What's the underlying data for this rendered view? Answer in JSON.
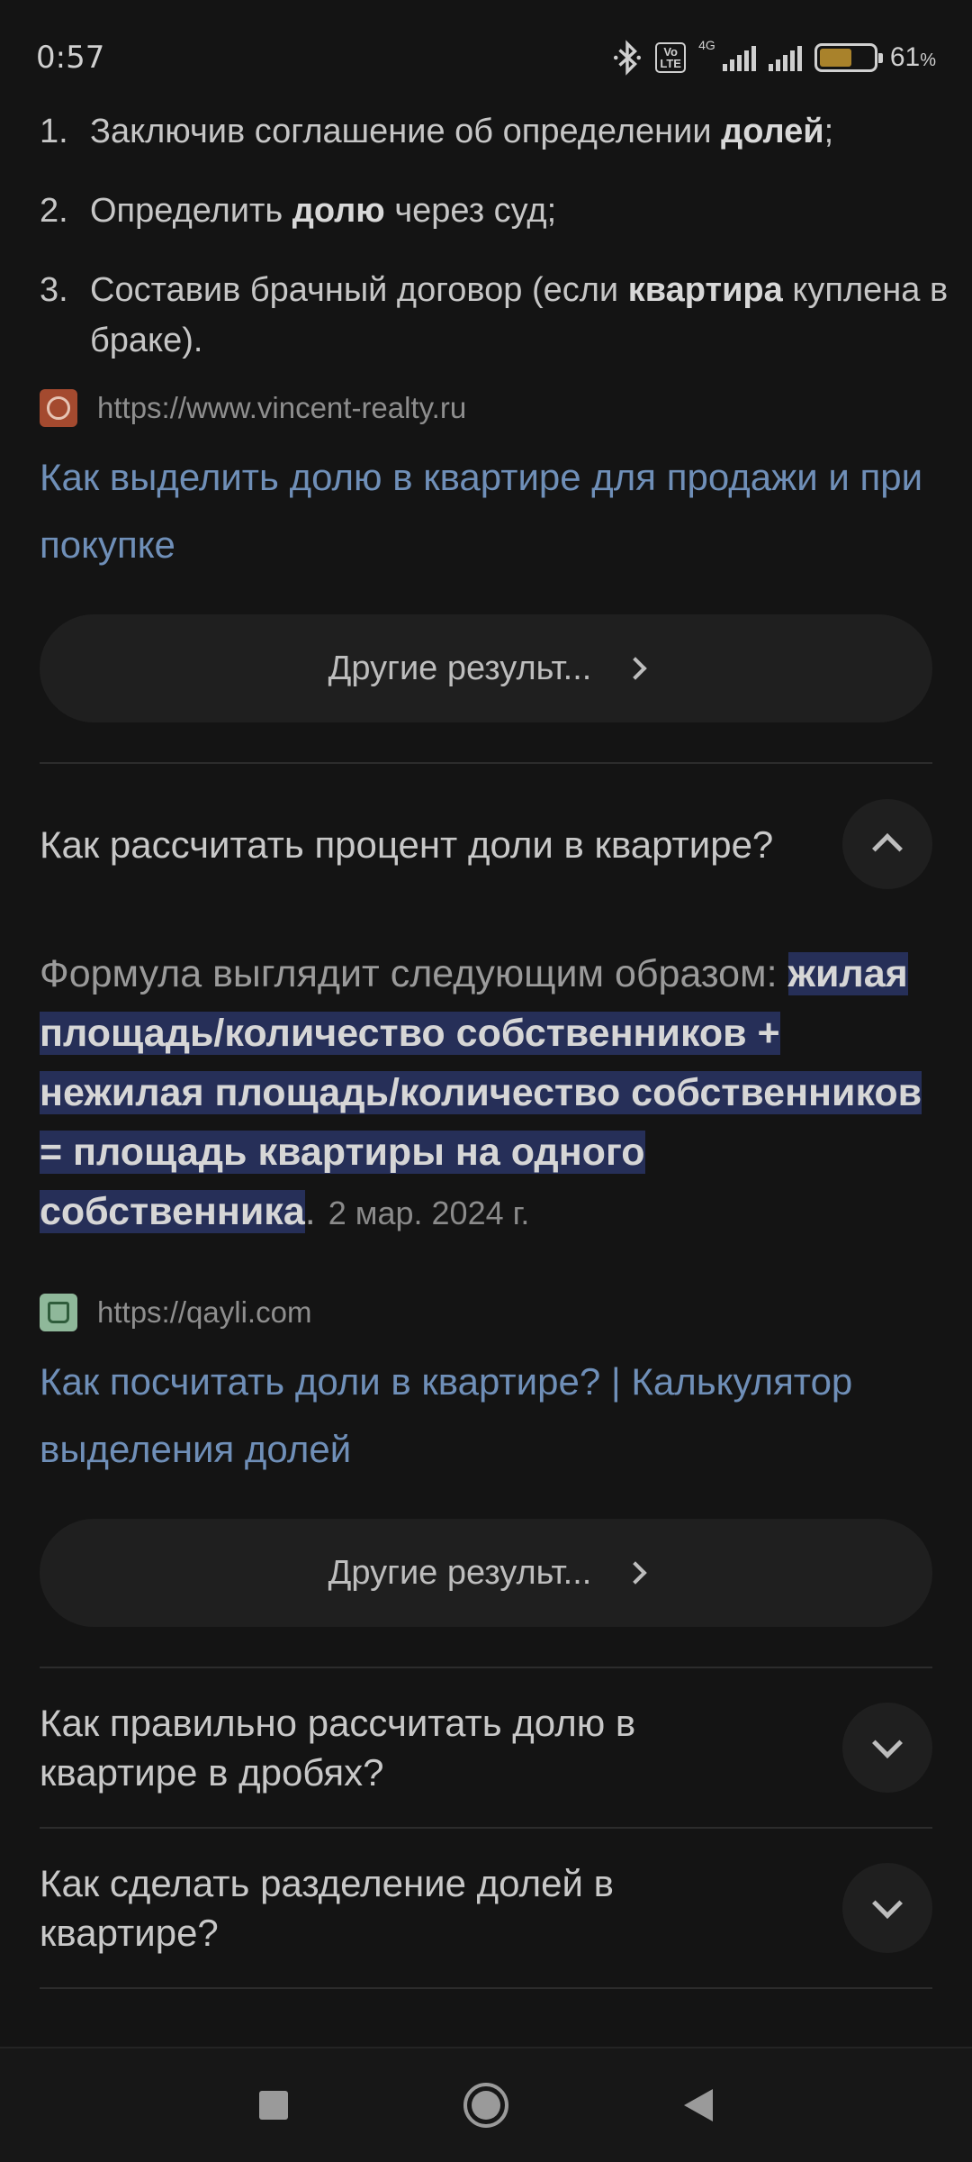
{
  "status_bar": {
    "time": "0:57",
    "volte": "Vo LTE",
    "network": "4G",
    "battery_percent": "61",
    "battery_unit": "%",
    "battery_level": 0.61,
    "icons": [
      "bluetooth-icon",
      "volte-icon",
      "signal-icon",
      "signal-icon",
      "battery-icon"
    ]
  },
  "list": [
    {
      "num": "1.",
      "before": "Заключив соглашение об определении ",
      "bold": "долей",
      "after": ";"
    },
    {
      "num": "2.",
      "before": "Определить ",
      "bold": "долю",
      "after": " через суд;"
    },
    {
      "num": "3.",
      "before": "Составив брачный договор (если ",
      "bold": "квартира",
      "after": " куплена в браке)."
    }
  ],
  "result1": {
    "url": "https://www.vincent-realty.ru",
    "title": "Как выделить долю в квартире для продажи и при покупке"
  },
  "more_button_label": "Другие результ...",
  "faq1": {
    "question": "Как рассчитать процент доли в квартире?",
    "answer_intro": "Формула выглядит следующим образом: ",
    "answer_highlight": "жилая площадь/количество собственников + нежилая площадь/количество собственников = площадь квартиры на одного собственника",
    "answer_end": ".",
    "date": "2 мар. 2024 г."
  },
  "result2": {
    "url": "https://qayli.com",
    "title": "Как посчитать доли в квартире? | Калькулятор выделения долей"
  },
  "faq2": {
    "question": "Как правильно рассчитать долю в квартире в дробях?"
  },
  "faq3": {
    "question": "Как сделать разделение долей в квартире?"
  },
  "nav": [
    "recents-button",
    "home-button",
    "back-button"
  ]
}
